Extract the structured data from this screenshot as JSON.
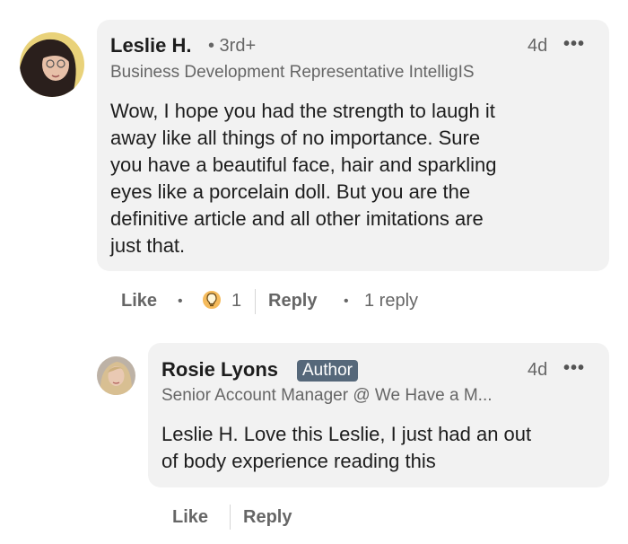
{
  "comment": {
    "author": "Leslie H.",
    "degree": "• 3rd+",
    "time": "4d",
    "headline": "Business Development Representative IntelligIS",
    "body_lines": [
      "Wow,   I hope you had the strength to laugh it",
      "away like all things of no importance.   Sure",
      "you have a beautiful face, hair and sparkling",
      "eyes like a porcelain doll. But you are the",
      "definitive article and all other imitations are",
      "just that."
    ],
    "like_label": "Like",
    "reaction_count": "1",
    "reply_label": "Reply",
    "replies_text": "1 reply",
    "more_icon": "more-options-icon",
    "reaction_icon": "insightful-bulb-icon"
  },
  "reply": {
    "author": "Rosie Lyons",
    "badge": "Author",
    "time": "4d",
    "headline": "Senior Account Manager @ We Have a M...",
    "body_lines": [
      "Leslie H. Love this Leslie, I just had an out",
      "of body experience reading this"
    ],
    "like_label": "Like",
    "reply_label": "Reply",
    "more_icon": "more-options-icon"
  }
}
